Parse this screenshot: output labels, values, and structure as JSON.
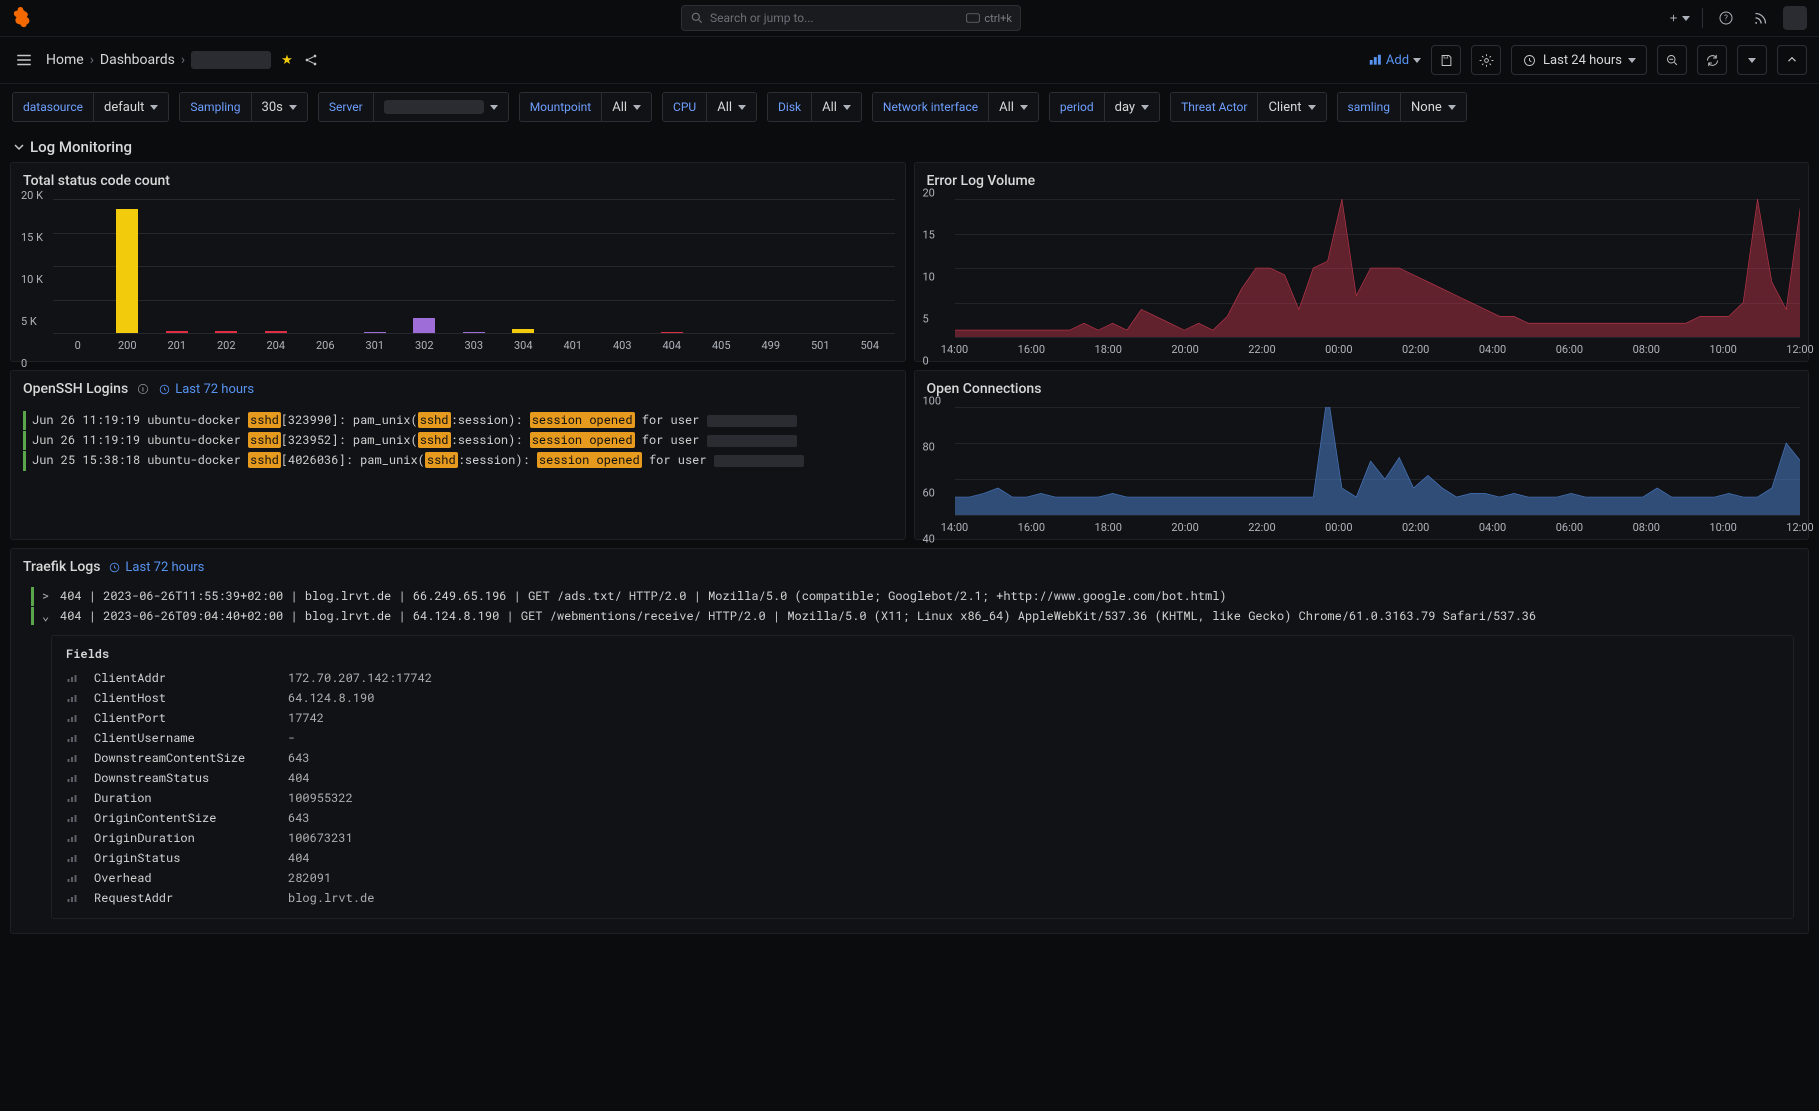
{
  "search": {
    "placeholder": "Search or jump to...",
    "kbd": "ctrl+k"
  },
  "breadcrumb": {
    "home": "Home",
    "dashboards": "Dashboards"
  },
  "toolbar": {
    "add": "Add",
    "timerange": "Last 24 hours"
  },
  "vars": [
    {
      "label": "datasource",
      "value": "default"
    },
    {
      "label": "Sampling",
      "value": "30s"
    },
    {
      "label": "Server",
      "value": ""
    },
    {
      "label": "Mountpoint",
      "value": "All"
    },
    {
      "label": "CPU",
      "value": "All"
    },
    {
      "label": "Disk",
      "value": "All"
    },
    {
      "label": "Network interface",
      "value": "All"
    },
    {
      "label": "period",
      "value": "day"
    },
    {
      "label": "Threat Actor",
      "value": "Client"
    },
    {
      "label": "samling",
      "value": "None"
    }
  ],
  "section": {
    "title": "Log Monitoring"
  },
  "panels": {
    "status": {
      "title": "Total status code count",
      "chart_data": {
        "type": "bar",
        "categories": [
          "0",
          "200",
          "201",
          "202",
          "204",
          "206",
          "301",
          "302",
          "303",
          "304",
          "401",
          "403",
          "404",
          "405",
          "499",
          "501",
          "504"
        ],
        "values": [
          0,
          18500,
          300,
          300,
          300,
          0,
          200,
          2200,
          200,
          600,
          0,
          0,
          200,
          0,
          0,
          0,
          0
        ],
        "colors": [
          "#888",
          "#F2CC0C",
          "#E02F44",
          "#E02F44",
          "#E02F44",
          "#888",
          "#9E6DD8",
          "#9E6DD8",
          "#9E6DD8",
          "#F2CC0C",
          "#888",
          "#888",
          "#E02F44",
          "#888",
          "#888",
          "#888",
          "#888"
        ],
        "ylabel": "",
        "yticks": [
          0,
          5000,
          10000,
          15000,
          20000
        ],
        "yticklabels": [
          "0",
          "5 K",
          "10 K",
          "15 K",
          "20 K"
        ]
      }
    },
    "error": {
      "title": "Error Log Volume",
      "chart_data": {
        "type": "area",
        "xlabels": [
          "14:00",
          "16:00",
          "18:00",
          "20:00",
          "22:00",
          "00:00",
          "02:00",
          "04:00",
          "06:00",
          "08:00",
          "10:00",
          "12:00"
        ],
        "yticks": [
          0,
          5,
          10,
          15,
          20
        ],
        "series": [
          {
            "name": "errors",
            "color": "#c4374e",
            "values": [
              1,
              1,
              1,
              1,
              1,
              1,
              1,
              1,
              1,
              2,
              1,
              2,
              1,
              4,
              3,
              2,
              1,
              2,
              1,
              3,
              7,
              10,
              10,
              9,
              4,
              10,
              11,
              20,
              6,
              10,
              10,
              10,
              9,
              8,
              7,
              6,
              5,
              4,
              3,
              3,
              2,
              2,
              2,
              2,
              2,
              2,
              2,
              2,
              2,
              2,
              2,
              2,
              3,
              3,
              3,
              5,
              20,
              8,
              4,
              19
            ]
          }
        ]
      }
    },
    "ssh": {
      "title": "OpenSSH Logins",
      "timerange": "Last 72 hours",
      "lines": [
        {
          "ts": "Jun 26 11:19:19",
          "host": "ubuntu-docker",
          "pid": "323990"
        },
        {
          "ts": "Jun 26 11:19:19",
          "host": "ubuntu-docker",
          "pid": "323952"
        },
        {
          "ts": "Jun 25 15:38:18",
          "host": "ubuntu-docker",
          "pid": "4026036"
        }
      ]
    },
    "conns": {
      "title": "Open Connections",
      "chart_data": {
        "type": "area",
        "xlabels": [
          "14:00",
          "16:00",
          "18:00",
          "20:00",
          "22:00",
          "00:00",
          "02:00",
          "04:00",
          "06:00",
          "08:00",
          "10:00",
          "12:00"
        ],
        "yticks": [
          40,
          60,
          80,
          100
        ],
        "series": [
          {
            "name": "connections",
            "color": "#4a7dc9",
            "values": [
              50,
              50,
              52,
              55,
              50,
              50,
              52,
              50,
              50,
              50,
              50,
              52,
              50,
              50,
              50,
              50,
              50,
              50,
              50,
              50,
              50,
              50,
              50,
              50,
              50,
              50,
              108,
              55,
              50,
              70,
              60,
              72,
              55,
              62,
              55,
              50,
              52,
              52,
              50,
              52,
              50,
              50,
              50,
              52,
              50,
              50,
              50,
              50,
              50,
              55,
              50,
              50,
              50,
              50,
              52,
              50,
              50,
              55,
              80,
              70
            ]
          }
        ]
      }
    },
    "traefik": {
      "title": "Traefik Logs",
      "timerange": "Last 72 hours",
      "rows": [
        {
          "expand": ">",
          "text": "404 | 2023-06-26T11:55:39+02:00 | blog.lrvt.de | 66.249.65.196 | GET /ads.txt/ HTTP/2.0 | Mozilla/5.0 (compatible; Googlebot/2.1; +http://www.google.com/bot.html)"
        },
        {
          "expand": "⌄",
          "text": "404 | 2023-06-26T09:04:40+02:00 | blog.lrvt.de | 64.124.8.190 | GET /webmentions/receive/ HTTP/2.0 | Mozilla/5.0 (X11; Linux x86_64) AppleWebKit/537.36 (KHTML, like Gecko) Chrome/61.0.3163.79 Safari/537.36"
        }
      ],
      "fieldsTitle": "Fields",
      "fields": [
        {
          "k": "ClientAddr",
          "v": "172.70.207.142:17742"
        },
        {
          "k": "ClientHost",
          "v": "64.124.8.190"
        },
        {
          "k": "ClientPort",
          "v": "17742"
        },
        {
          "k": "ClientUsername",
          "v": "-"
        },
        {
          "k": "DownstreamContentSize",
          "v": "643"
        },
        {
          "k": "DownstreamStatus",
          "v": "404"
        },
        {
          "k": "Duration",
          "v": "100955322"
        },
        {
          "k": "OriginContentSize",
          "v": "643"
        },
        {
          "k": "OriginDuration",
          "v": "100673231"
        },
        {
          "k": "OriginStatus",
          "v": "404"
        },
        {
          "k": "Overhead",
          "v": "282091"
        },
        {
          "k": "RequestAddr",
          "v": "blog.lrvt.de"
        }
      ]
    }
  }
}
